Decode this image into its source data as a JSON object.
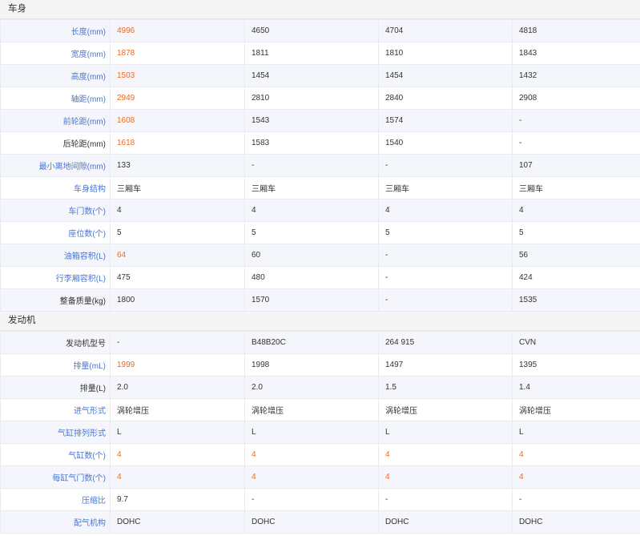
{
  "colors": {
    "highlight": "#f06a1c",
    "link": "#4a76d4",
    "shade": "#f4f6fb"
  },
  "sections": [
    {
      "title": "车身",
      "rows": [
        {
          "label": "长度(mm)",
          "link": true,
          "shaded": true,
          "values": [
            "4996",
            "4650",
            "4704",
            "4818"
          ],
          "hl": [
            true,
            false,
            false,
            false
          ]
        },
        {
          "label": "宽度(mm)",
          "link": true,
          "shaded": false,
          "values": [
            "1878",
            "1811",
            "1810",
            "1843"
          ],
          "hl": [
            true,
            false,
            false,
            false
          ]
        },
        {
          "label": "高度(mm)",
          "link": true,
          "shaded": true,
          "values": [
            "1503",
            "1454",
            "1454",
            "1432"
          ],
          "hl": [
            true,
            false,
            false,
            false
          ]
        },
        {
          "label": "轴距(mm)",
          "link": true,
          "shaded": false,
          "values": [
            "2949",
            "2810",
            "2840",
            "2908"
          ],
          "hl": [
            true,
            false,
            false,
            false
          ]
        },
        {
          "label": "前轮距(mm)",
          "link": true,
          "shaded": true,
          "values": [
            "1608",
            "1543",
            "1574",
            "-"
          ],
          "hl": [
            true,
            false,
            false,
            false
          ]
        },
        {
          "label": "后轮距(mm)",
          "link": false,
          "shaded": false,
          "values": [
            "1618",
            "1583",
            "1540",
            "-"
          ],
          "hl": [
            true,
            false,
            false,
            false
          ]
        },
        {
          "label": "最小离地间隙(mm)",
          "link": true,
          "shaded": true,
          "values": [
            "133",
            "-",
            "-",
            "107"
          ],
          "hl": [
            false,
            false,
            false,
            false
          ]
        },
        {
          "label": "车身结构",
          "link": true,
          "shaded": false,
          "values": [
            "三厢车",
            "三厢车",
            "三厢车",
            "三厢车"
          ],
          "hl": [
            false,
            false,
            false,
            false
          ]
        },
        {
          "label": "车门数(个)",
          "link": true,
          "shaded": true,
          "values": [
            "4",
            "4",
            "4",
            "4"
          ],
          "hl": [
            false,
            false,
            false,
            false
          ]
        },
        {
          "label": "座位数(个)",
          "link": true,
          "shaded": false,
          "values": [
            "5",
            "5",
            "5",
            "5"
          ],
          "hl": [
            false,
            false,
            false,
            false
          ]
        },
        {
          "label": "油箱容积(L)",
          "link": true,
          "shaded": true,
          "values": [
            "64",
            "60",
            "-",
            "56"
          ],
          "hl": [
            true,
            false,
            false,
            false
          ]
        },
        {
          "label": "行李厢容积(L)",
          "link": true,
          "shaded": false,
          "values": [
            "475",
            "480",
            "-",
            "424"
          ],
          "hl": [
            false,
            false,
            false,
            false
          ]
        },
        {
          "label": "整备质量(kg)",
          "link": false,
          "shaded": true,
          "values": [
            "1800",
            "1570",
            "-",
            "1535"
          ],
          "hl": [
            false,
            false,
            false,
            false
          ]
        }
      ]
    },
    {
      "title": "发动机",
      "rows": [
        {
          "label": "发动机型号",
          "link": false,
          "shaded": true,
          "values": [
            "-",
            "B48B20C",
            "264 915",
            "CVN"
          ],
          "hl": [
            false,
            false,
            false,
            false
          ]
        },
        {
          "label": "排量(mL)",
          "link": true,
          "shaded": false,
          "values": [
            "1999",
            "1998",
            "1497",
            "1395"
          ],
          "hl": [
            true,
            false,
            false,
            false
          ]
        },
        {
          "label": "排量(L)",
          "link": false,
          "shaded": true,
          "values": [
            "2.0",
            "2.0",
            "1.5",
            "1.4"
          ],
          "hl": [
            false,
            false,
            false,
            false
          ]
        },
        {
          "label": "进气形式",
          "link": true,
          "shaded": false,
          "values": [
            "涡轮增压",
            "涡轮增压",
            "涡轮增压",
            "涡轮增压"
          ],
          "hl": [
            false,
            false,
            false,
            false
          ]
        },
        {
          "label": "气缸排列形式",
          "link": true,
          "shaded": true,
          "values": [
            "L",
            "L",
            "L",
            "L"
          ],
          "hl": [
            false,
            false,
            false,
            false
          ]
        },
        {
          "label": "气缸数(个)",
          "link": true,
          "shaded": false,
          "values": [
            "4",
            "4",
            "4",
            "4"
          ],
          "hl": [
            true,
            true,
            true,
            true
          ]
        },
        {
          "label": "每缸气门数(个)",
          "link": true,
          "shaded": true,
          "values": [
            "4",
            "4",
            "4",
            "4"
          ],
          "hl": [
            true,
            true,
            true,
            true
          ]
        },
        {
          "label": "压缩比",
          "link": true,
          "shaded": false,
          "values": [
            "9.7",
            "-",
            "-",
            "-"
          ],
          "hl": [
            false,
            false,
            false,
            false
          ]
        },
        {
          "label": "配气机构",
          "link": true,
          "shaded": true,
          "values": [
            "DOHC",
            "DOHC",
            "DOHC",
            "DOHC"
          ],
          "hl": [
            false,
            false,
            false,
            false
          ]
        }
      ]
    }
  ]
}
